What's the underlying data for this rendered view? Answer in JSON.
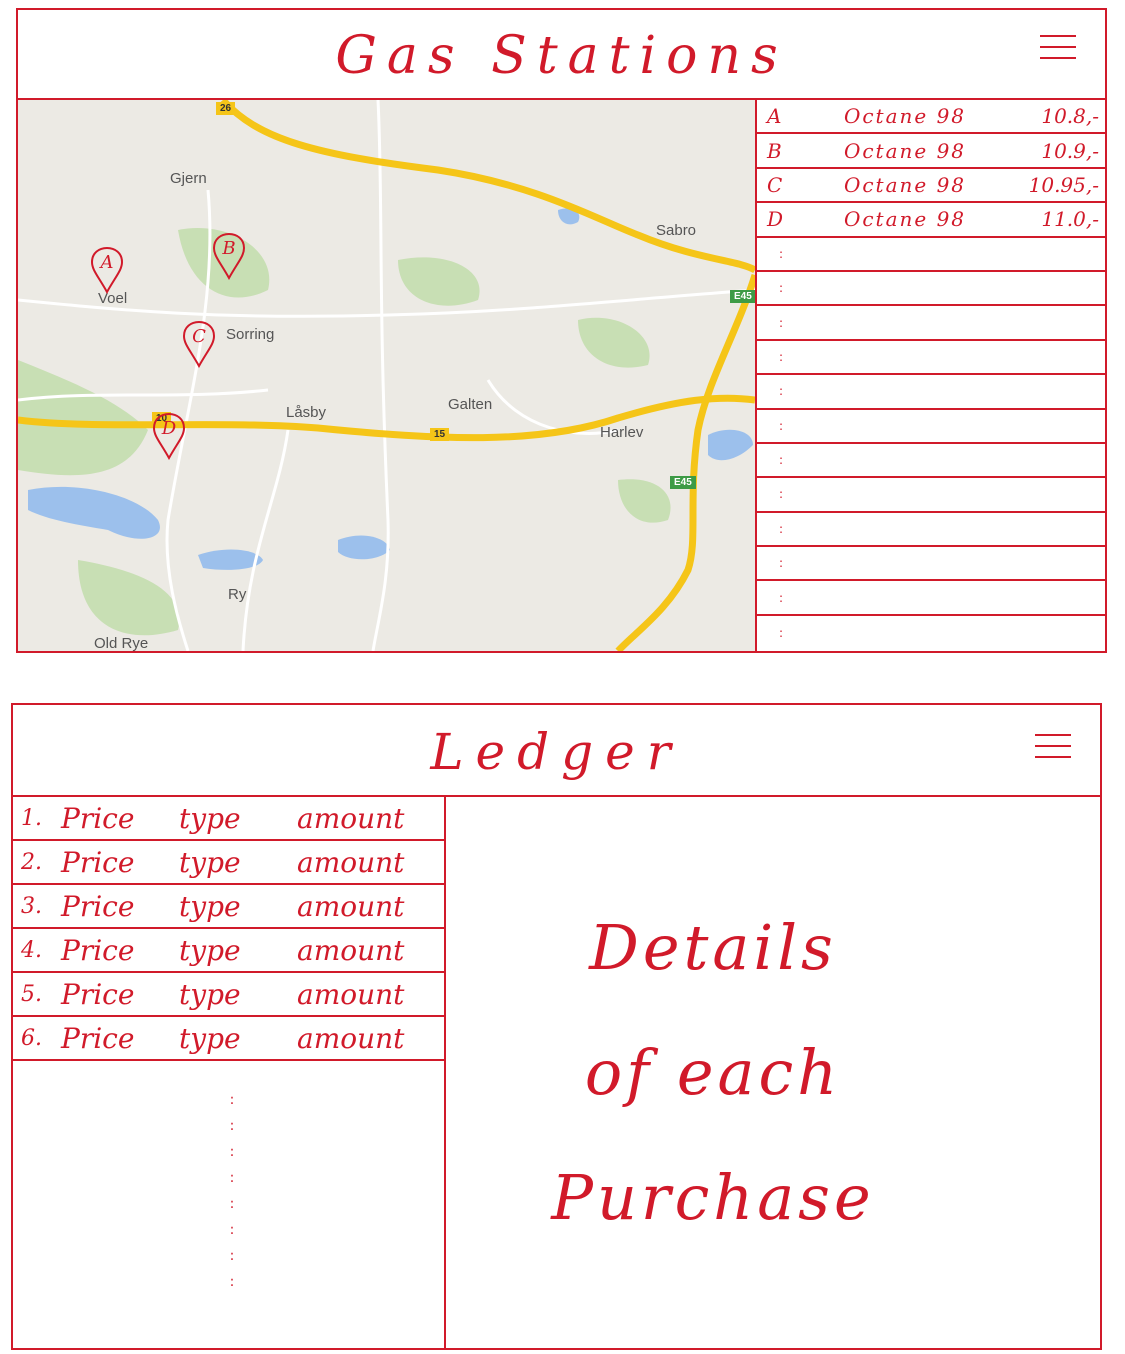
{
  "gas_stations": {
    "title": "Gas Stations",
    "map": {
      "towns": [
        "Gjern",
        "Sabro",
        "Voel",
        "Sorring",
        "Låsby",
        "Galten",
        "Harlev",
        "Ry",
        "Old Rye"
      ],
      "shields": [
        "26",
        "E45",
        "15",
        "10",
        "E45"
      ],
      "pins": [
        "A",
        "B",
        "C",
        "D"
      ]
    },
    "stations": [
      {
        "letter": "A",
        "octane": "Octane 98",
        "price": "10.8,-"
      },
      {
        "letter": "B",
        "octane": "Octane 98",
        "price": "10.9,-"
      },
      {
        "letter": "C",
        "octane": "Octane 98",
        "price": "10.95,-"
      },
      {
        "letter": "D",
        "octane": "Octane 98",
        "price": "11.0,-"
      }
    ],
    "empty_row_marker": ":"
  },
  "ledger": {
    "title": "Ledger",
    "entries": [
      {
        "num": "1.",
        "price": "Price",
        "type": "type",
        "amount": "amount"
      },
      {
        "num": "2.",
        "price": "Price",
        "type": "type",
        "amount": "amount"
      },
      {
        "num": "3.",
        "price": "Price",
        "type": "type",
        "amount": "amount"
      },
      {
        "num": "4.",
        "price": "Price",
        "type": "type",
        "amount": "amount"
      },
      {
        "num": "5.",
        "price": "Price",
        "type": "type",
        "amount": "amount"
      },
      {
        "num": "6.",
        "price": "Price",
        "type": "type",
        "amount": "amount"
      }
    ],
    "more_marker": ":",
    "details": [
      "Details",
      "of each",
      "Purchase"
    ]
  },
  "colors": {
    "ink": "#d11a2a",
    "map_bg": "#eceae4",
    "road": "#f5c518",
    "water": "#9cc0ec",
    "forest": "#c8dfb4"
  },
  "icons": [
    "menu-icon",
    "map-pin-icon"
  ]
}
